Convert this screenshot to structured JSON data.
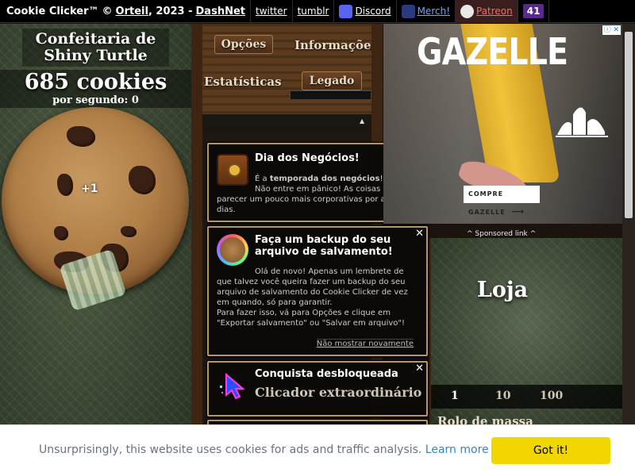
{
  "topbar": {
    "brand": "Cookie Clicker™",
    "copyright": "©",
    "author": "Orteil",
    "year_sep": ", 2023 -",
    "dashnet": "DashNet",
    "links": [
      "twitter",
      "tumblr",
      "Discord",
      "Merch!",
      "Patreon"
    ],
    "badge": "41",
    "icon_names": [
      "discord-icon",
      "merch-icon",
      "patreon-icon"
    ]
  },
  "left": {
    "bakery_name": "Confeitaria de Shiny Turtle",
    "cookies": "685 cookies",
    "per_second": "por segundo: 0",
    "click_popup": "+1"
  },
  "menu": {
    "options": "Opções",
    "info": "Informações",
    "stats": "Estatísticas",
    "legacy": "Legado"
  },
  "notes": [
    {
      "title": "Dia dos Negócios!",
      "body_line1_pre": "É a ",
      "body_line1_bold": "temporada dos negócios",
      "body_line1_post": "!",
      "body_line2": "Não entre em pânico! As coisas vão",
      "body_rest": "parecer um pouco mais corporativas por alguns dias.",
      "icon": "briefcase-icon"
    },
    {
      "title": "Faça um backup do seu arquivo de salvamento!",
      "body_line1": "Olá de novo! Apenas um lembrete de",
      "body_rest": "que talvez você queira fazer um backup do seu arquivo de salvamento do Cookie Clicker de vez em quando, só para garantir.",
      "body_line3": "Para fazer isso, vá para Opções e clique em \"Exportar salvamento\" ou \"Salvar em arquivo\"!",
      "dismiss": "Não mostrar novamente",
      "icon": "rainbow-cookie-icon"
    },
    {
      "title": "Conquista desbloqueada",
      "achievement": "Clicador extraordinário",
      "icon": "cursor-icon"
    }
  ],
  "ad": {
    "headline": "GAZELLE",
    "cta": "COMPRE GAZELLE",
    "cta_arrow": "⟶",
    "choice_icon": "ⓘ",
    "choice_close": "✕",
    "sponsored": "^ Sponsored link ^"
  },
  "store": {
    "title": "Loja",
    "buy_amounts": [
      "1",
      "10",
      "100"
    ],
    "first_item": "Rolo de massa"
  },
  "consent": {
    "message": "Unsurprisingly, this website uses cookies for ads and traffic analysis.",
    "learn_more": "Learn more",
    "button": "Got it!"
  },
  "colors": {
    "accent_yellow": "#f1d600",
    "link_blue": "#3b82c4",
    "note_border": "#b8975c"
  }
}
